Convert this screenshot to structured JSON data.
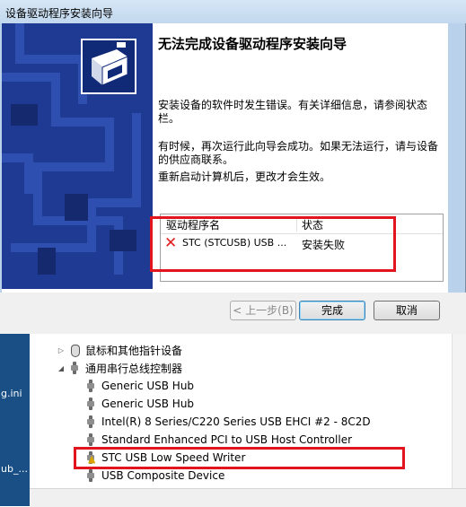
{
  "dialog": {
    "title": "设备驱动程序安装向导",
    "heading": "无法完成设备驱动程序安装向导",
    "message1": "安装设备的软件时发生错误。有关详细信息，请参阅状态栏。",
    "message2": "有时候，再次运行此向导会成功。如果无法运行，请与设备的供应商联系。",
    "message3": "重新启动计算机后，更改才会生效。",
    "list": {
      "col_driver": "驱动程序名",
      "col_status": "状态",
      "rows": [
        {
          "driver": "STC (STCUSB) USB  ...",
          "status": "安装失败",
          "icon": "red-x-icon"
        }
      ]
    },
    "buttons": {
      "back": "< 上一步(B)",
      "finish": "完成",
      "cancel": "取消"
    }
  },
  "device_manager": {
    "tree": [
      {
        "label": "鼠标和其他指针设备",
        "icon": "mouse-icon",
        "expanded": false
      },
      {
        "label": "通用串行总线控制器",
        "icon": "usb-controller-icon",
        "expanded": true
      },
      {
        "label": "Generic USB Hub",
        "icon": "usb-icon"
      },
      {
        "label": "Generic USB Hub",
        "icon": "usb-icon"
      },
      {
        "label": "Intel(R) 8 Series/C220 Series USB EHCI #2 - 8C2D",
        "icon": "usb-icon"
      },
      {
        "label": "Standard Enhanced PCI to USB Host Controller",
        "icon": "usb-icon"
      },
      {
        "label": "STC USB Low Speed Writer",
        "icon": "usb-warning-icon"
      },
      {
        "label": "USB Composite Device",
        "icon": "usb-icon"
      }
    ],
    "left_fragments": [
      "g.ini",
      "ub_..."
    ]
  },
  "colors": {
    "highlight_box": "#e2141e",
    "wizard_side": "#1f3a92",
    "dialog_frame": "#b9d1ea"
  }
}
